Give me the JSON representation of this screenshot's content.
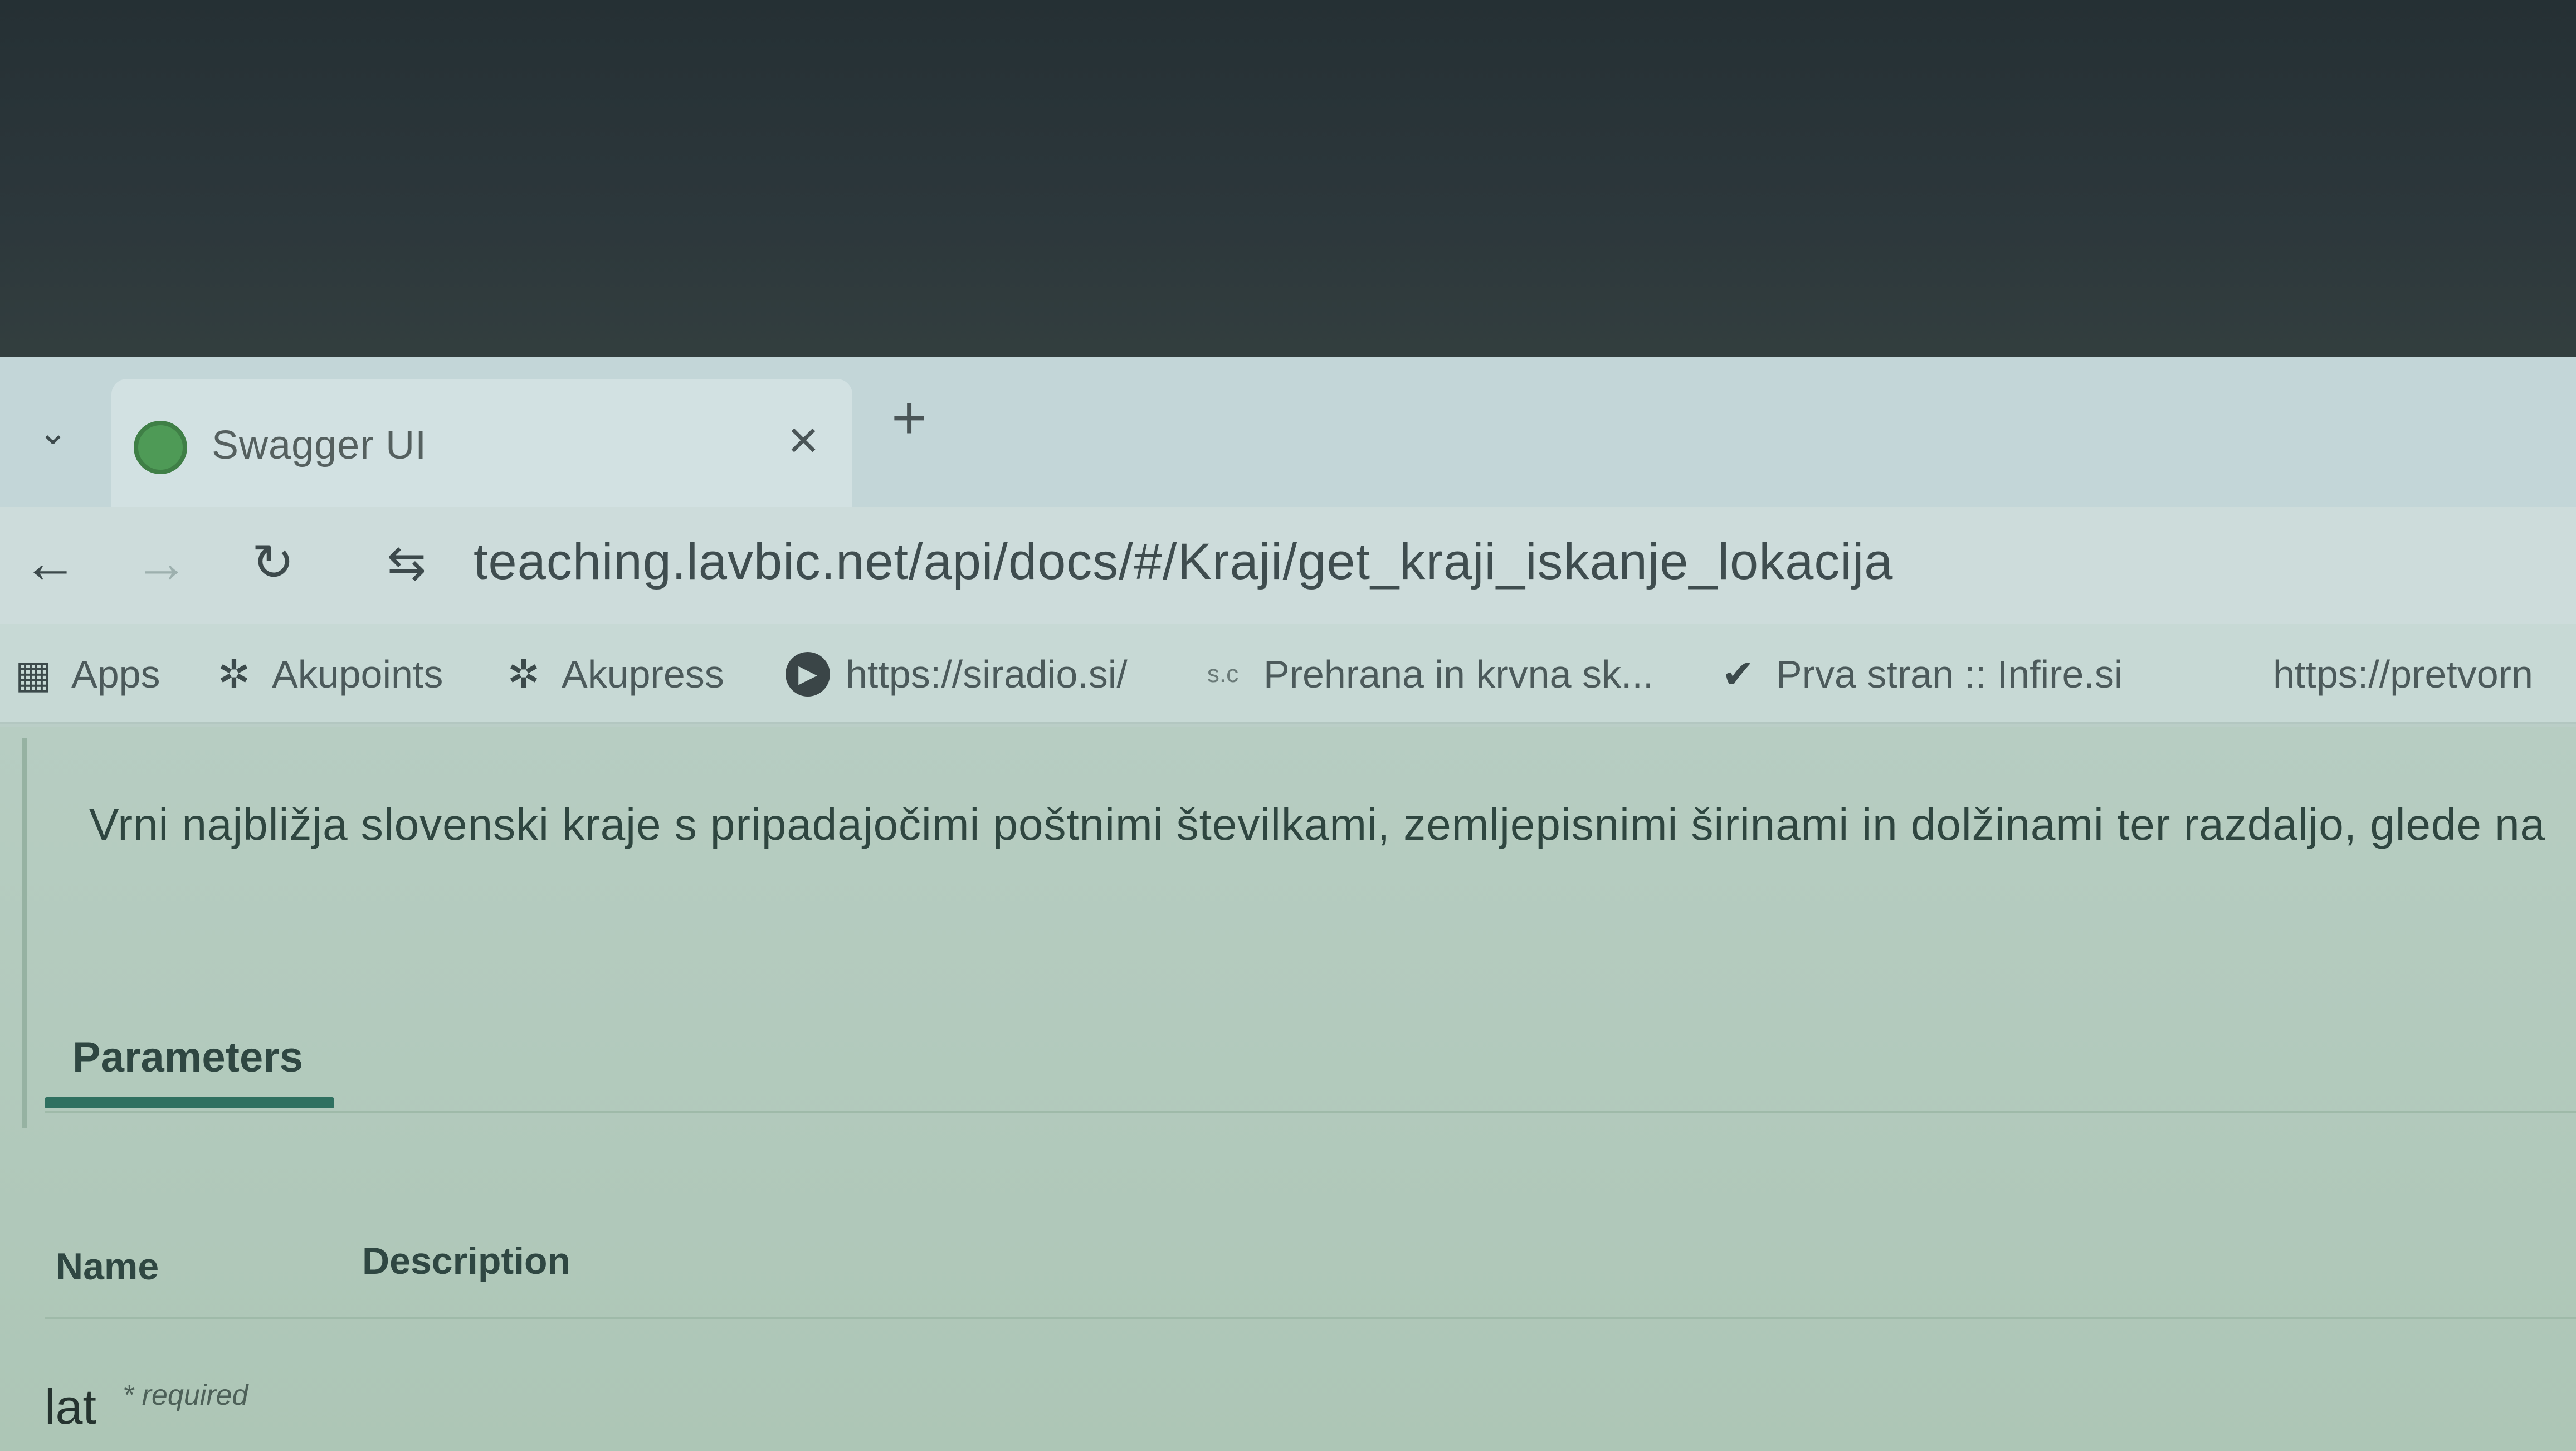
{
  "browser": {
    "tab": {
      "title": "Swagger UI",
      "favicon": "swagger-favicon"
    },
    "address": "teaching.lavbic.net/api/docs/#/Kraji/get_kraji_iskanje_lokacija",
    "bookmarks": [
      {
        "label": "Apps",
        "icon": "apps-grid-icon"
      },
      {
        "label": "Akupoints",
        "icon": "puzzle-icon"
      },
      {
        "label": "Akupress",
        "icon": "puzzle-icon"
      },
      {
        "label": "https://siradio.si/",
        "icon": "play-icon"
      },
      {
        "label": "Prehrana in krvna sk...",
        "icon_text": "s.c"
      },
      {
        "label": "Prva stran :: Infire.si",
        "icon": "checkmark-icon"
      },
      {
        "label": "https://pretvorn"
      }
    ]
  },
  "operation": {
    "description": "Vrni najbližja slovenski kraje s pripadajočimi poštnimi številkami, zemljepisnimi širinami in dolžinami ter razdaljo, glede na",
    "parameters_tab": "Parameters",
    "columns": {
      "name": "Name",
      "description": "Description"
    },
    "parameters": [
      {
        "name": "lat",
        "required_label": "* required"
      }
    ]
  },
  "colors": {
    "accent": "#2f7060",
    "favicon": "#4e9a56"
  }
}
